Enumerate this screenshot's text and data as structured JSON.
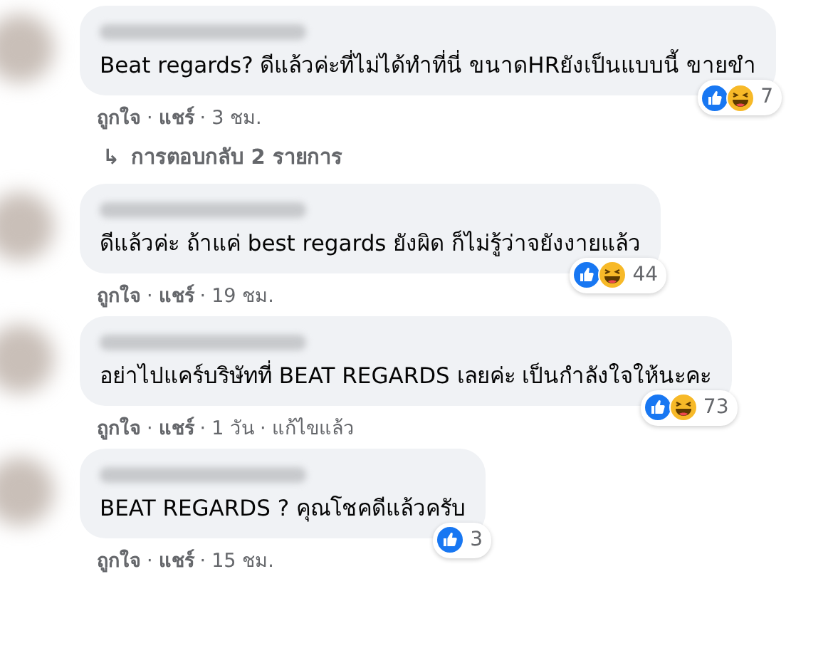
{
  "comments": [
    {
      "text": "Beat regards? ดีแล้วค่ะที่ไม่ได้ทำที่นี่ ขนาดHRยังเป็นแบบนี้ ขายขำ",
      "reactions": [
        {
          "kind": "like"
        },
        {
          "kind": "haha"
        }
      ],
      "reaction_count": "7",
      "actions": [
        {
          "kind": "action",
          "text": "ถูกใจ"
        },
        {
          "kind": "dot",
          "text": "·"
        },
        {
          "kind": "action",
          "text": "แชร์"
        },
        {
          "kind": "dot",
          "text": "·"
        },
        {
          "kind": "meta",
          "text": "3 ชม."
        }
      ],
      "replies_link": {
        "icon": "↳",
        "text": "การตอบกลับ 2 รายการ"
      }
    },
    {
      "text": "ดีแล้วค่ะ ถ้าแค่ best regards ยังผิด ก็ไม่รู้ว่าจยังงายแล้ว",
      "reactions": [
        {
          "kind": "like"
        },
        {
          "kind": "haha"
        }
      ],
      "reaction_count": "44",
      "actions": [
        {
          "kind": "action",
          "text": "ถูกใจ"
        },
        {
          "kind": "dot",
          "text": "·"
        },
        {
          "kind": "action",
          "text": "แชร์"
        },
        {
          "kind": "dot",
          "text": "·"
        },
        {
          "kind": "meta",
          "text": "19 ชม."
        }
      ]
    },
    {
      "text": "อย่าไปแคร์บริษัทที่ BEAT REGARDS เลยค่ะ เป็นกำลังใจให้นะคะ",
      "reactions": [
        {
          "kind": "like"
        },
        {
          "kind": "haha"
        }
      ],
      "reaction_count": "73",
      "actions": [
        {
          "kind": "action",
          "text": "ถูกใจ"
        },
        {
          "kind": "dot",
          "text": "·"
        },
        {
          "kind": "action",
          "text": "แชร์"
        },
        {
          "kind": "dot",
          "text": "·"
        },
        {
          "kind": "meta",
          "text": "1 วัน"
        },
        {
          "kind": "dot",
          "text": "·"
        },
        {
          "kind": "meta",
          "text": "แก้ไขแล้ว"
        }
      ]
    },
    {
      "text": "BEAT REGARDS ? คุณโชคดีแล้วครับ",
      "reactions": [
        {
          "kind": "like"
        }
      ],
      "reaction_count": "3",
      "actions": [
        {
          "kind": "action",
          "text": "ถูกใจ"
        },
        {
          "kind": "dot",
          "text": "·"
        },
        {
          "kind": "action",
          "text": "แชร์"
        },
        {
          "kind": "dot",
          "text": "·"
        },
        {
          "kind": "meta",
          "text": "15 ชม."
        }
      ]
    }
  ]
}
